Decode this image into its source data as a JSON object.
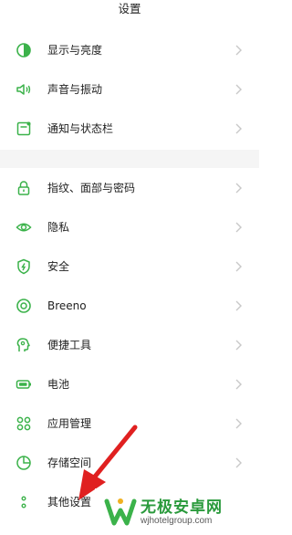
{
  "header": {
    "title": "设置"
  },
  "colors": {
    "accent": "#3bb24a",
    "chevron": "#c8c8c8",
    "arrow": "#e02020"
  },
  "group1": [
    {
      "label": "显示与亮度",
      "icon": "brightness-icon"
    },
    {
      "label": "声音与振动",
      "icon": "speaker-icon"
    },
    {
      "label": "通知与状态栏",
      "icon": "notification-icon"
    }
  ],
  "group2": [
    {
      "label": "指纹、面部与密码",
      "icon": "lock-icon"
    },
    {
      "label": "隐私",
      "icon": "eye-icon"
    },
    {
      "label": "安全",
      "icon": "shield-icon"
    },
    {
      "label": "Breeno",
      "icon": "breeno-icon"
    },
    {
      "label": "便捷工具",
      "icon": "tool-icon"
    },
    {
      "label": "电池",
      "icon": "battery-icon"
    },
    {
      "label": "应用管理",
      "icon": "apps-icon"
    },
    {
      "label": "存储空间",
      "icon": "storage-icon"
    },
    {
      "label": "其他设置",
      "icon": "more-icon"
    }
  ],
  "watermark": {
    "title": "无极安卓网",
    "url": "wjhotelgroup.com"
  }
}
